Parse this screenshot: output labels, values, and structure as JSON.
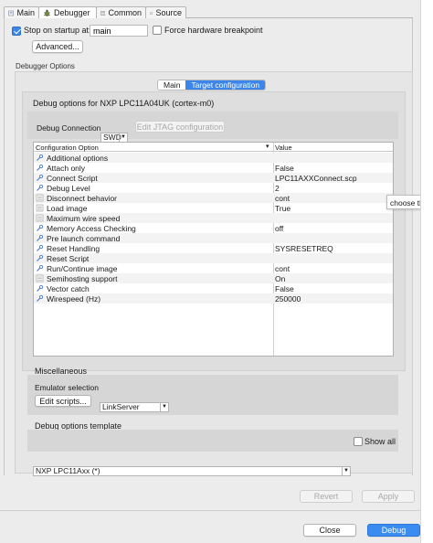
{
  "tabs": [
    {
      "label": "Main",
      "icon": "main-tab-icon"
    },
    {
      "label": "Debugger",
      "icon": "debugger-tab-icon",
      "active": true
    },
    {
      "label": "Common",
      "icon": "common-tab-icon"
    },
    {
      "label": "Source",
      "icon": "source-tab-icon"
    }
  ],
  "startup": {
    "stop_label": "Stop on startup at:",
    "stop_checked": true,
    "stop_value": "main",
    "force_label": "Force hardware breakpoint",
    "force_checked": false,
    "advanced_label": "Advanced..."
  },
  "debugger_options_label": "Debugger Options",
  "inner_tabs": [
    {
      "label": "Main",
      "active": false
    },
    {
      "label": "Target configuration",
      "active": true
    }
  ],
  "debug_options": {
    "title": "Debug options for NXP LPC11A04UK (cortex-m0)",
    "connection_label": "Debug Connection",
    "connection_value": "SWD",
    "jtag_button": "Edit JTAG configuration"
  },
  "config_table": {
    "col_option": "Configuration Option",
    "col_value": "Value",
    "sort_indicator": "▾",
    "rows": [
      {
        "name": "Additional options",
        "value": ""
      },
      {
        "name": "Attach only",
        "value": "False"
      },
      {
        "name": "Connect Script",
        "value": "LPC11AXXConnect.scp"
      },
      {
        "name": "Debug Level",
        "value": "2"
      },
      {
        "name": "Disconnect behavior",
        "value": "cont"
      },
      {
        "name": "Load image",
        "value": "True"
      },
      {
        "name": "Maximum wire speed",
        "value": ""
      },
      {
        "name": "Memory Access Checking",
        "value": "off"
      },
      {
        "name": "Pre launch command",
        "value": ""
      },
      {
        "name": "Reset Handling",
        "value": "SYSRESETREQ"
      },
      {
        "name": "Reset Script",
        "value": ""
      },
      {
        "name": "Run/Continue image",
        "value": "cont"
      },
      {
        "name": "Semihosting support",
        "value": "On"
      },
      {
        "name": "Vector catch",
        "value": "False"
      },
      {
        "name": "Wirespeed (Hz)",
        "value": "250000"
      }
    ]
  },
  "tooltip": "choose the d",
  "misc": {
    "label": "Miscellaneous",
    "emulator_label": "Emulator selection",
    "emulator_value": "LinkServer",
    "edit_scripts": "Edit scripts..."
  },
  "template": {
    "label": "Debug options template",
    "value": "NXP LPC11Axx (*)",
    "show_all_label": "Show all",
    "show_all_checked": false
  },
  "footer": {
    "revert": "Revert",
    "apply": "Apply",
    "close": "Close",
    "debug": "Debug"
  },
  "colors": {
    "accent": "#3b86e8",
    "primary_button": "#3b8cf0"
  }
}
